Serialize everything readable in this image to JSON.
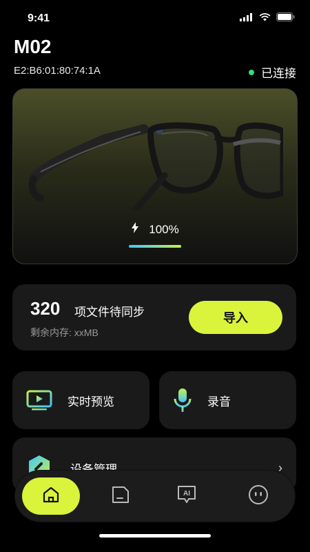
{
  "status": {
    "time": "9:41"
  },
  "device": {
    "name": "M02",
    "mac": "E2:B6:01:80:74:1A",
    "connection": "已连接"
  },
  "battery": {
    "label": "100%",
    "level": 1.0
  },
  "sync": {
    "count": "320",
    "text": "项文件待同步",
    "memory": "剩余内存: xxMB",
    "import_label": "导入"
  },
  "actions": {
    "preview": "实时预览",
    "record": "录音"
  },
  "device_mgmt": {
    "label": "设备管理"
  },
  "colors": {
    "accent": "#d9f43b",
    "connected": "#2ee07a",
    "card": "#1a1a1a"
  },
  "tabs": [
    "home-icon",
    "files-icon",
    "ai-icon",
    "me-icon"
  ]
}
